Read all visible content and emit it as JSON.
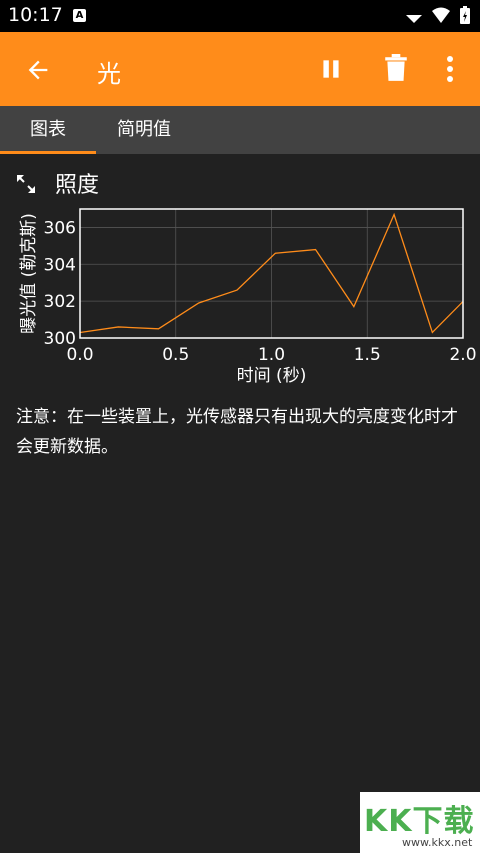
{
  "status": {
    "time": "10:17",
    "notif_icon": "A"
  },
  "app_bar": {
    "title": "光"
  },
  "tabs": [
    {
      "label": "图表"
    },
    {
      "label": "简明值"
    }
  ],
  "section": {
    "title": "照度"
  },
  "chart_data": {
    "type": "line",
    "title": "",
    "xlabel": "时间 (秒)",
    "ylabel": "曝光值 (勒克斯)",
    "xlim": [
      0,
      2.0
    ],
    "ylim": [
      300,
      307
    ],
    "x_ticks": [
      "0.0",
      "0.5",
      "1.0",
      "1.5",
      "2.0"
    ],
    "y_ticks": [
      "300",
      "302",
      "304",
      "306"
    ],
    "grid": true,
    "colors": {
      "line": "#ff8c1a",
      "grid": "#555555",
      "frame": "#ffffff"
    },
    "x": [
      0.0,
      0.2,
      0.41,
      0.62,
      0.82,
      1.02,
      1.23,
      1.43,
      1.64,
      1.84,
      2.04
    ],
    "y": [
      300.3,
      300.6,
      300.5,
      301.9,
      302.6,
      304.6,
      304.8,
      301.7,
      306.7,
      300.3,
      302.4
    ]
  },
  "note": {
    "text": "注意：在一些装置上，光传感器只有出现大的亮度变化时才会更新数据。"
  },
  "watermark": {
    "text": "KK下载",
    "url": "www.kkx.net"
  }
}
